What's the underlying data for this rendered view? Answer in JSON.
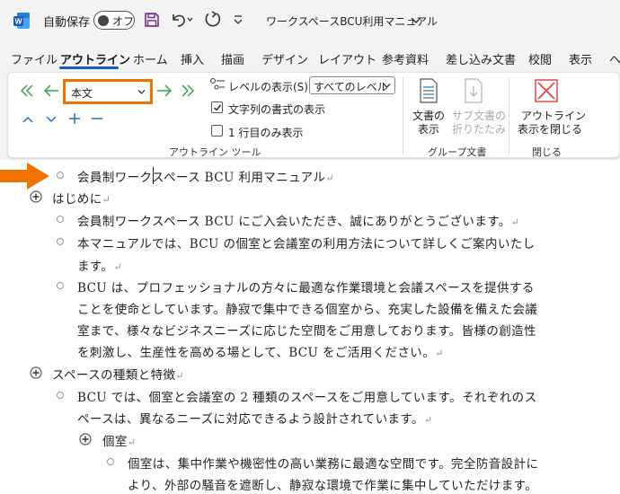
{
  "titlebar": {
    "autosave_label": "自動保存",
    "autosave_state": "オフ",
    "document_title": "ワークスペースBCU利用マニュアル"
  },
  "tabs": [
    {
      "label": "ファイル"
    },
    {
      "label": "アウトライン"
    },
    {
      "label": "ホーム"
    },
    {
      "label": "挿入"
    },
    {
      "label": "描画"
    },
    {
      "label": "デザイン"
    },
    {
      "label": "レイアウト"
    },
    {
      "label": "参考資料"
    },
    {
      "label": "差し込み文書"
    },
    {
      "label": "校閲"
    },
    {
      "label": "表示"
    },
    {
      "label": "ヘ"
    }
  ],
  "ribbon": {
    "outline_tools": {
      "level_value": "本文",
      "show_level_label": "レベルの表示(S):",
      "show_level_value": "すべてのレベル",
      "show_formatting_label": "文字列の書式の表示",
      "show_first_line_label": "1 行目のみ表示",
      "group_label": "アウトライン ツール"
    },
    "master_document": {
      "show_document_line1": "文書の",
      "show_document_line2": "表示",
      "collapse_subdocs_line1": "サブ文書の",
      "collapse_subdocs_line2": "折りたたみ",
      "group_label": "グループ文書"
    },
    "close": {
      "close_outline_line1": "アウトライン",
      "close_outline_line2": "表示を閉じる",
      "group_label": "閉じる"
    }
  },
  "accent_colors": {
    "orange_highlight": "#f07300",
    "tab_underline": "#185abd",
    "close_x": "#e8393a"
  },
  "document": {
    "lines": [
      {
        "text": "会員制ワークスペース BCU  利用マニュアル"
      },
      {
        "text": "はじめに"
      },
      {
        "text": "会員制ワークスペース BCU にご入会いただき、誠にありがとうございます。"
      },
      {
        "text": "本マニュアルでは、BCU の個室と会議室の利用方法について詳しくご案内いたし"
      },
      {
        "text": "ます。"
      },
      {
        "text": "BCU は、プロフェッショナルの方々に最適な作業環境と会議スペースを提供する"
      },
      {
        "text": "ことを使命としています。静寂で集中できる個室から、充実した設備を備えた会議"
      },
      {
        "text": "室まで、様々なビジネスニーズに応じた空間をご用意しております。皆様の創造性"
      },
      {
        "text": "を刺激し、生産性を高める場として、BCU をご活用ください。"
      },
      {
        "text": "スペースの種類と特徴"
      },
      {
        "text": "BCU では、個室と会議室の 2 種類のスペースをご用意しています。それぞれのス"
      },
      {
        "text": "ペースは、異なるニーズに対応できるよう設計されています。"
      },
      {
        "text": "個室"
      },
      {
        "text": "個室は、集中作業や機密性の高い業務に最適な空間です。完全防音設計に"
      },
      {
        "text": "より、外部の騒音を遮断し、静寂な環境で作業に集中していただけます。"
      }
    ]
  }
}
